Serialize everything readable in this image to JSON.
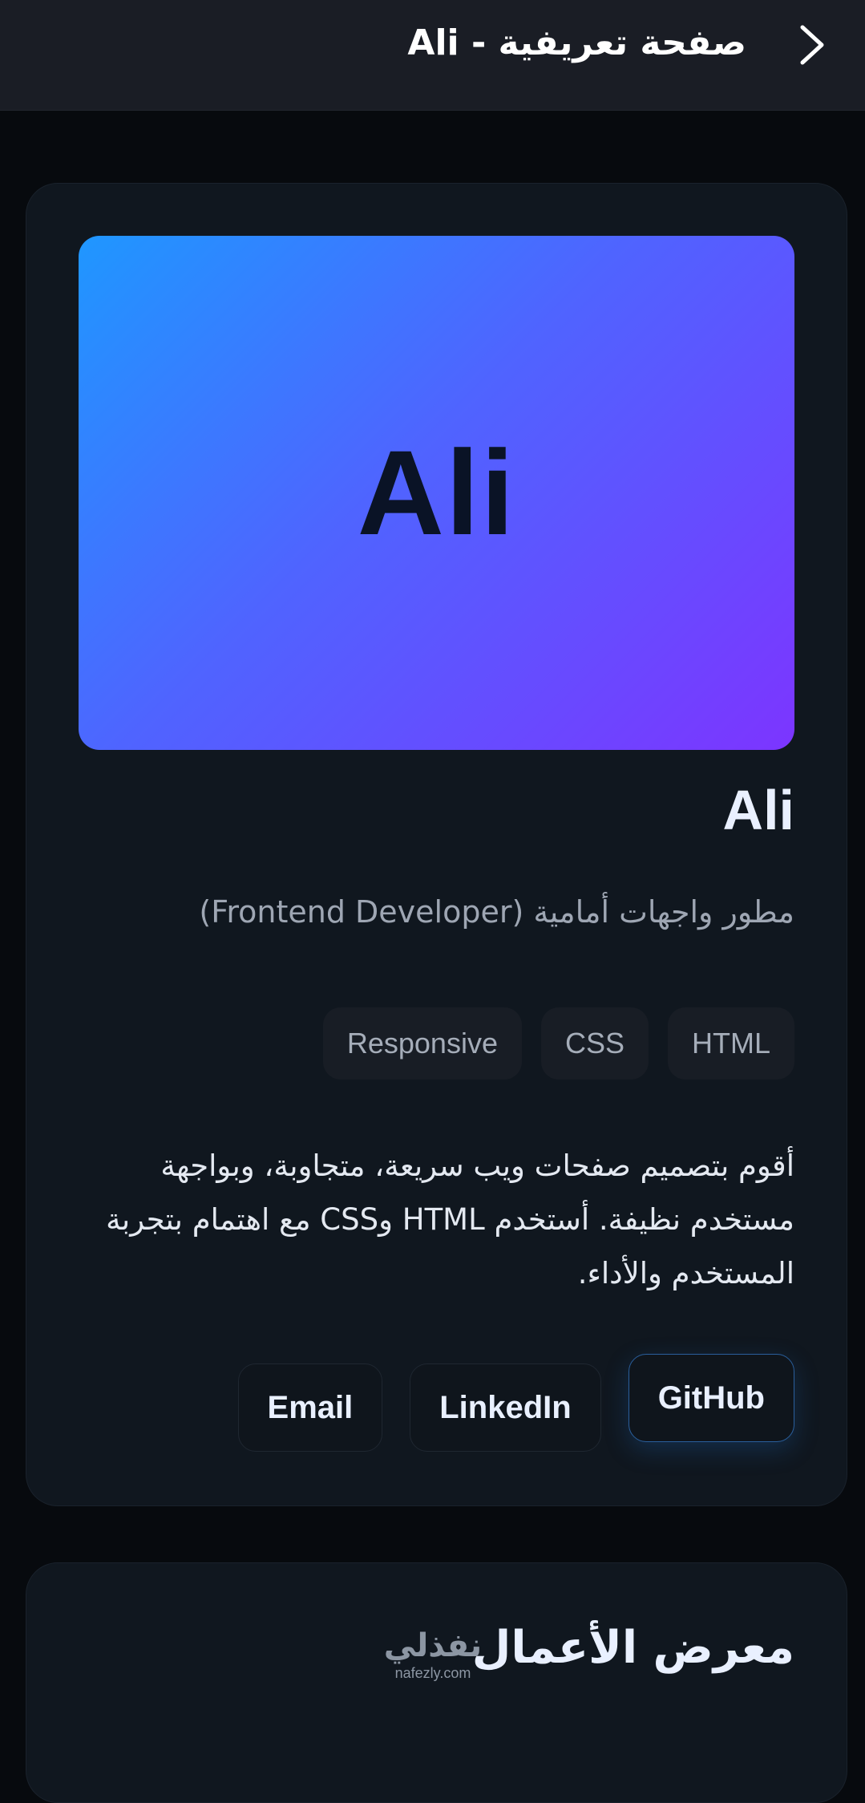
{
  "header": {
    "title": "صفحة تعريفية - Ali",
    "back_icon": "chevron-right-icon"
  },
  "profile": {
    "hero_text": "Ali",
    "name": "Ali",
    "role": "مطور واجهات أمامية (Frontend Developer)",
    "tags": [
      "HTML",
      "CSS",
      "Responsive"
    ],
    "bio": "أقوم بتصميم صفحات ويب سريعة، متجاوبة، وبواجهة مستخدم نظيفة. أستخدم HTML وCSS مع اهتمام بتجربة المستخدم والأداء.",
    "links": {
      "github": "GitHub",
      "linkedin": "LinkedIn",
      "email": "Email"
    }
  },
  "portfolio": {
    "title": "معرض الأعمال"
  },
  "watermark": {
    "arabic": "نفذلي",
    "latin": "nafezly.com"
  },
  "colors": {
    "background": "#070a0e",
    "topbar": "#1a1d25",
    "card": "#10171f",
    "hero_gradient_start": "#1f97ff",
    "hero_gradient_end": "#7c35ff",
    "accent_border": "#2a5f9c"
  }
}
